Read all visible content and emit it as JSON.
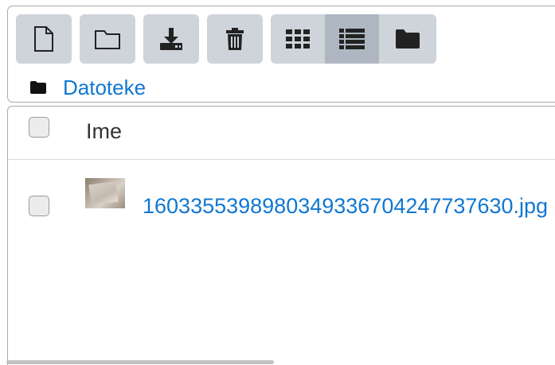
{
  "toolbar": {
    "buttons": [
      {
        "icon": "new-file-icon"
      },
      {
        "icon": "new-folder-icon"
      },
      {
        "icon": "download-icon"
      },
      {
        "icon": "delete-icon"
      }
    ],
    "view_modes": [
      {
        "icon": "grid-view-icon",
        "active": false
      },
      {
        "icon": "list-view-icon",
        "active": true
      },
      {
        "icon": "folder-view-icon",
        "active": false
      }
    ]
  },
  "path": {
    "icon": "folder-icon",
    "label": "Datoteke"
  },
  "table": {
    "header": {
      "name": "Ime"
    },
    "rows": [
      {
        "name": "1603355398980349336704247737630.jpg",
        "thumbnail": "image-thumbnail"
      }
    ]
  },
  "colors": {
    "link": "#1177d1",
    "button_bg": "#ced4da",
    "button_active_bg": "#aeb7c1",
    "border": "#a9a9a9"
  }
}
